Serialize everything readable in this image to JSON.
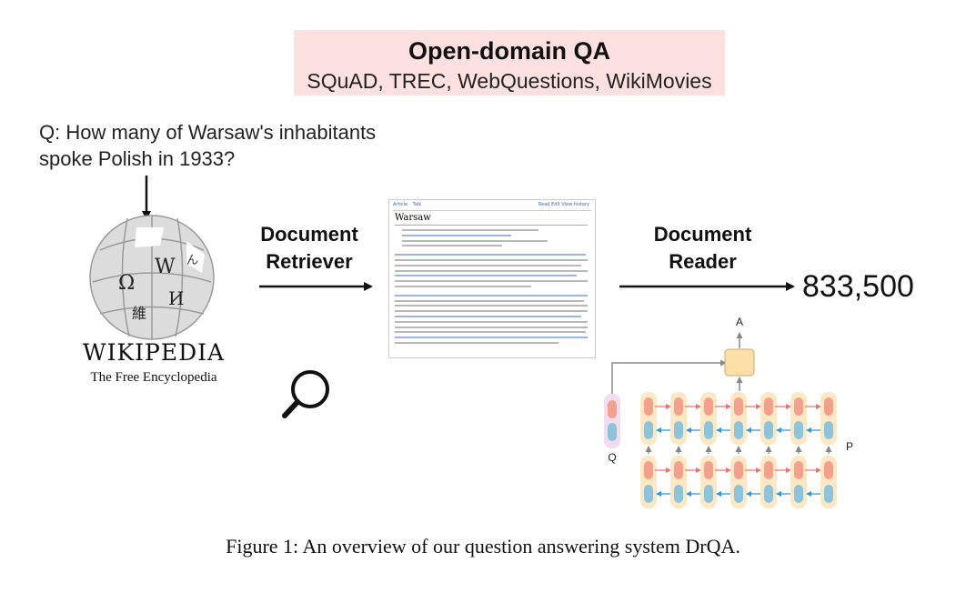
{
  "header": {
    "title": "Open-domain QA",
    "subtitle": "SQuAD, TREC, WebQuestions, WikiMovies"
  },
  "question": {
    "text": "Q:  How many of Warsaw's inhabitants spoke Polish in 1933?"
  },
  "wikipedia": {
    "name": "WIKIPEDIA",
    "tagline": "The Free Encyclopedia"
  },
  "stages": {
    "retriever": "Document Retriever",
    "reader": "Document Reader"
  },
  "document": {
    "title": "Warsaw",
    "tab_article": "Article",
    "tab_talk": "Talk",
    "tab_right": "Read  Edit  View history"
  },
  "answer": {
    "text": "833,500"
  },
  "reader_labels": {
    "answer_label": "A",
    "question_label": "Q",
    "passage_label": "P"
  },
  "caption": {
    "text": "Figure 1:  An overview of our question answering system DrQA."
  },
  "colors": {
    "title_bg": "#fde0e0",
    "forward_cell": "#f5a08c",
    "backward_cell": "#8cc4dc",
    "column_bg": "#fde8c4",
    "output_box": "#fde0a8",
    "question_bg": "#f2dcf0"
  }
}
